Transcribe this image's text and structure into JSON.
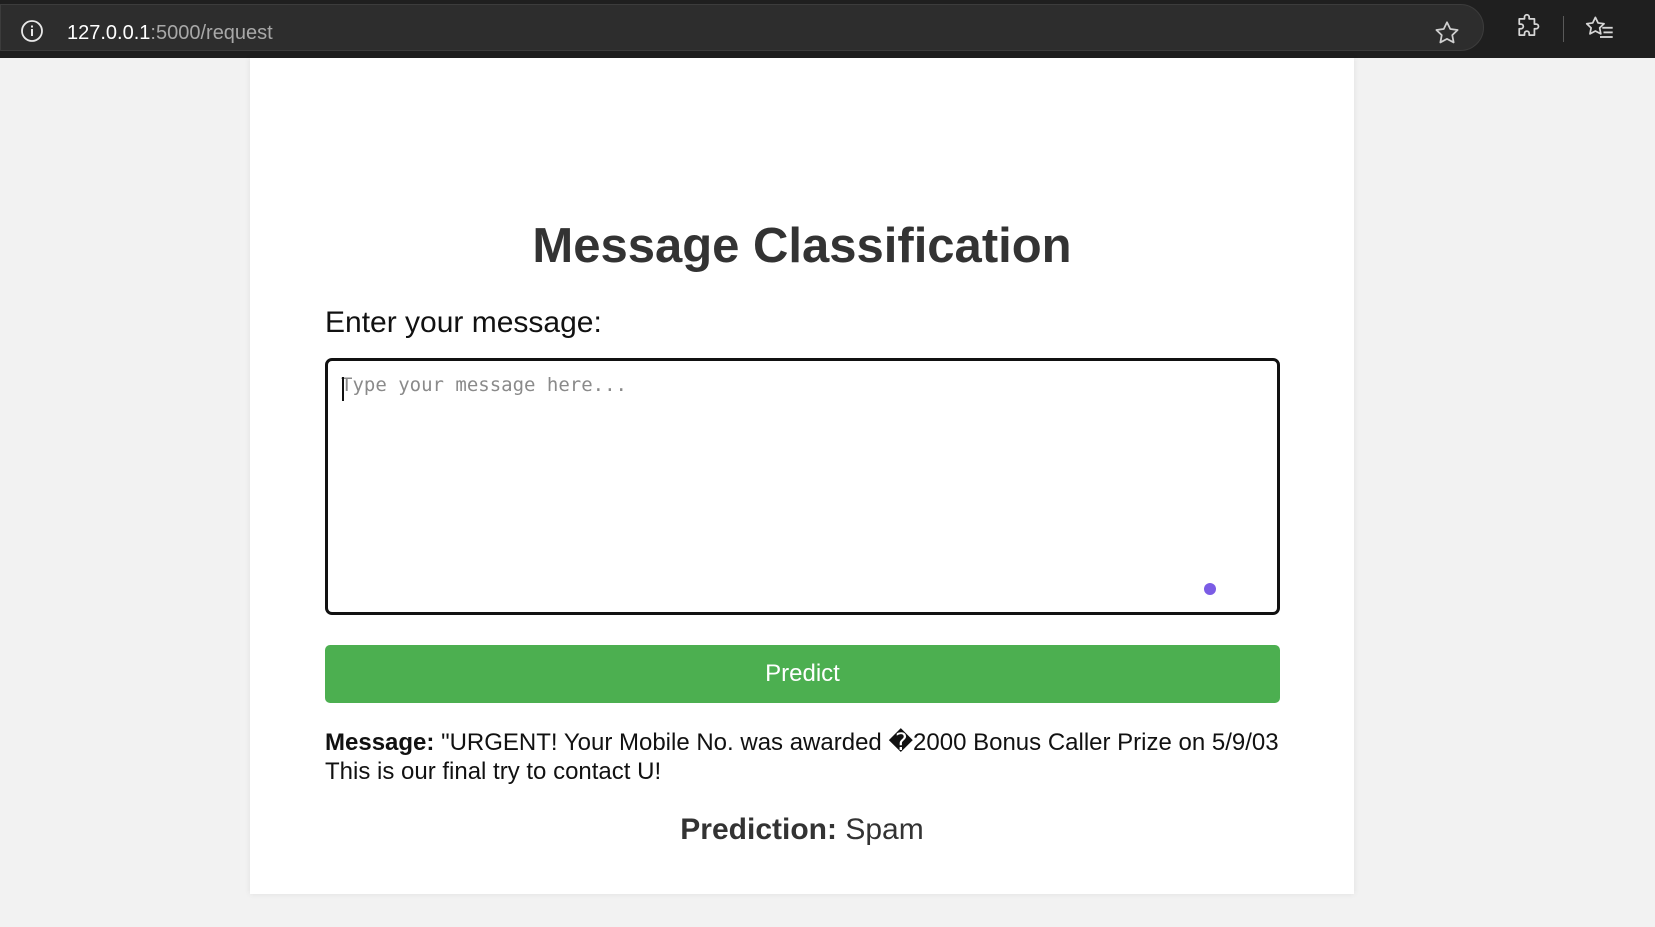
{
  "browser": {
    "url_host": "127.0.0.1",
    "url_path": ":5000/request",
    "icons": [
      "info-icon",
      "bookmark-star-icon",
      "extensions-icon",
      "favorites-icon"
    ]
  },
  "page": {
    "title": "Message Classification",
    "input_label": "Enter your message:",
    "textarea": {
      "placeholder": "Type your message here...",
      "value": ""
    },
    "predict_button": "Predict",
    "result": {
      "message_label": "Message:",
      "message_text": "\"URGENT! Your Mobile No. was awarded �2000 Bonus Caller Prize on 5/9/03 This is our final try to contact U!",
      "prediction_label": "Prediction:",
      "prediction_value": "Spam"
    }
  },
  "colors": {
    "page_background": "#f2f2f2",
    "card_background": "#ffffff",
    "button": "#4caf50",
    "button_text": "#ffffff",
    "title_text": "#333333",
    "chrome_background": "#1f1f1f",
    "grammar_dot": "#7b5ce5"
  }
}
